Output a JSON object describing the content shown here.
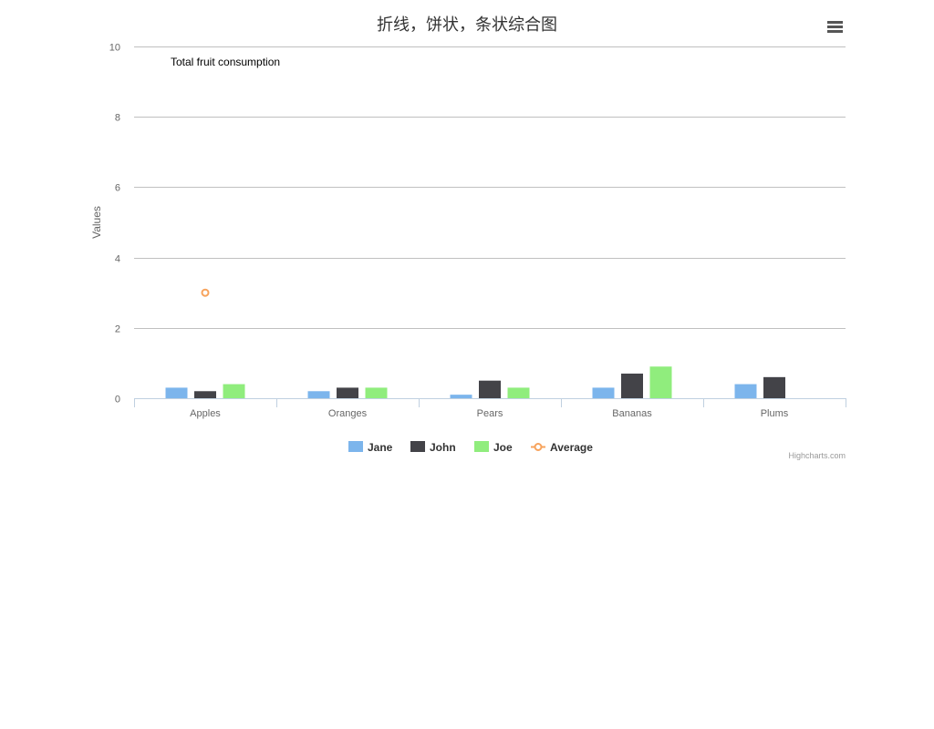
{
  "menu": {
    "icon": "hamburger-menu-icon"
  },
  "credits": "Highcharts.com",
  "chart_data": {
    "type": "bar",
    "title": "折线，饼状，条状综合图",
    "xlabel": "",
    "ylabel": "Values",
    "ylim": [
      0,
      10
    ],
    "yticks": [
      "0",
      "2",
      "4",
      "6",
      "8",
      "10"
    ],
    "grid": true,
    "categories": [
      "Apples",
      "Oranges",
      "Pears",
      "Bananas",
      "Plums"
    ],
    "series": [
      {
        "name": "Jane",
        "type": "column",
        "color": "#7cb5ec",
        "values": [
          0.3,
          0.2,
          0.1,
          0.3,
          0.4
        ]
      },
      {
        "name": "John",
        "type": "column",
        "color": "#434348",
        "values": [
          0.2,
          0.3,
          0.5,
          0.7,
          0.6
        ]
      },
      {
        "name": "Joe",
        "type": "column",
        "color": "#90ed7d",
        "values": [
          0.4,
          0.3,
          0.3,
          0.9,
          0.0
        ]
      },
      {
        "name": "Average",
        "type": "line",
        "color": "#f7a35c",
        "values": [
          3.0,
          null,
          null,
          null,
          null
        ]
      }
    ],
    "pie": {
      "title": "Total fruit consumption"
    },
    "legend_placement": "bottom-center"
  }
}
